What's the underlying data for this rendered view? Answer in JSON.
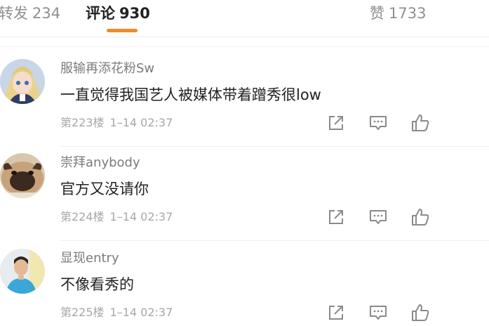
{
  "tabs": {
    "forward": {
      "label": "转发",
      "count": "234"
    },
    "comments": {
      "label": "评论",
      "count": "930"
    },
    "likes": {
      "label": "赞",
      "count": "1733"
    }
  },
  "accent_color": "#f08a24",
  "comments": [
    {
      "username": "服输再添花粉Sw",
      "text": "一直觉得我国艺人被媒体带着蹭秀很low",
      "floor": "第223楼",
      "time": "1–14 02:37"
    },
    {
      "username": "崇拜anybody",
      "text": "官方又没请你",
      "floor": "第224楼",
      "time": "1–14 02:37"
    },
    {
      "username": "显现entry",
      "text": "不像看秀的",
      "floor": "第225楼",
      "time": "1–14 02:37"
    }
  ],
  "icons": {
    "share": "share-icon",
    "reply": "comment-icon",
    "like": "thumbs-up-icon"
  }
}
